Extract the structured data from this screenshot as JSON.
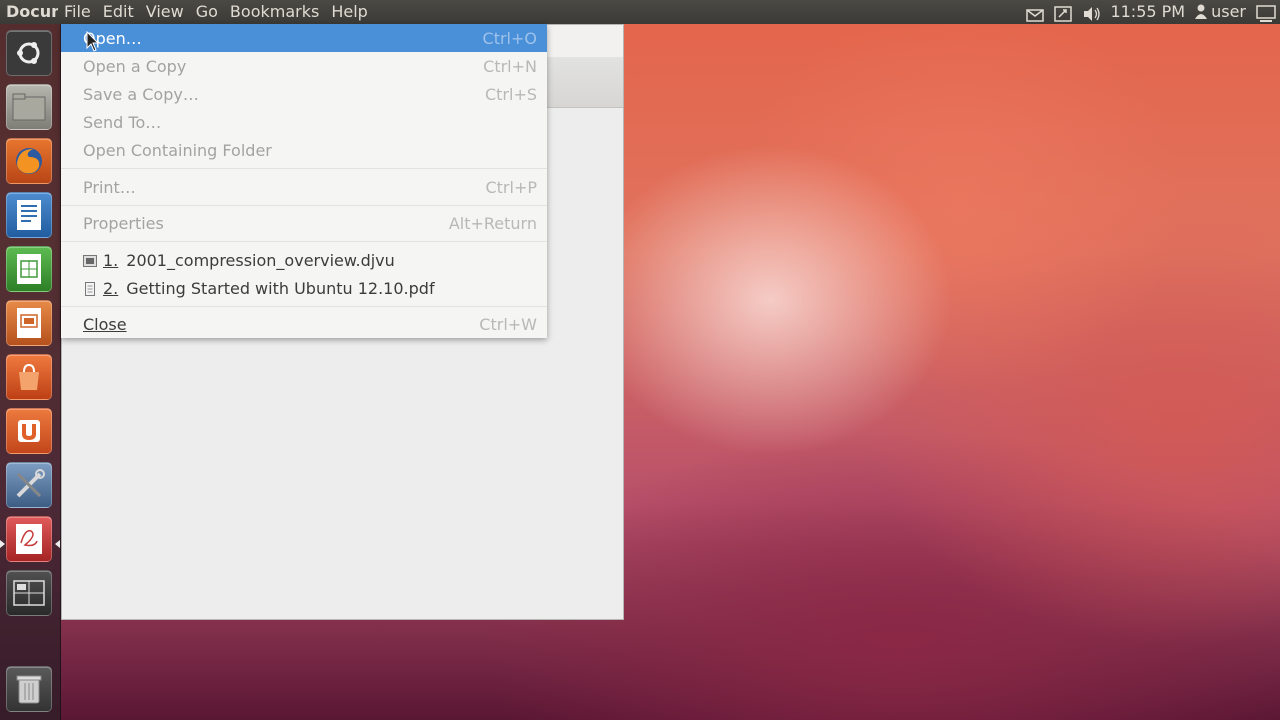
{
  "top_panel": {
    "app_title": "Docun",
    "menus": [
      "File",
      "Edit",
      "View",
      "Go",
      "Bookmarks",
      "Help"
    ],
    "clock": "11:55 PM",
    "user": "user",
    "indicator_icons": [
      "mail-icon",
      "keyboard-icon",
      "volume-icon",
      "user-icon",
      "system-settings-icon"
    ]
  },
  "launcher": {
    "items": [
      {
        "name": "dash-home",
        "icon": "ubuntu-logo-icon",
        "color": "#3b3b3b"
      },
      {
        "name": "files",
        "icon": "folder-icon",
        "color": "#8a8a80"
      },
      {
        "name": "firefox",
        "icon": "firefox-icon",
        "color": "#e0662b"
      },
      {
        "name": "libreoffice-writer",
        "icon": "writer-icon",
        "color": "#2f6fb0"
      },
      {
        "name": "libreoffice-calc",
        "icon": "calc-icon",
        "color": "#3f9a3a"
      },
      {
        "name": "libreoffice-impress",
        "icon": "impress-icon",
        "color": "#d0652a"
      },
      {
        "name": "software-center",
        "icon": "shopping-bag-icon",
        "color": "#e26030"
      },
      {
        "name": "ubuntu-one",
        "icon": "ubuntu-one-icon",
        "color": "#e0602a"
      },
      {
        "name": "system-settings",
        "icon": "tools-icon",
        "color": "#4d6f95"
      },
      {
        "name": "document-viewer",
        "icon": "document-viewer-icon",
        "color": "#c83a3a"
      },
      {
        "name": "workspace-switcher",
        "icon": "workspace-icon",
        "color": "#3a3a3a"
      },
      {
        "name": "trash",
        "icon": "trash-icon",
        "color": "#4a4a4a"
      }
    ]
  },
  "file_menu": {
    "items": [
      {
        "label": "Open…",
        "accel": "Ctrl+O",
        "state": "active"
      },
      {
        "label": "Open a Copy",
        "accel": "Ctrl+N",
        "state": "disabled"
      },
      {
        "label": "Save a Copy…",
        "accel": "Ctrl+S",
        "state": "disabled"
      },
      {
        "label": "Send To…",
        "accel": "",
        "state": "disabled"
      },
      {
        "label": "Open Containing Folder",
        "accel": "",
        "state": "disabled"
      },
      {
        "label": "Print…",
        "accel": "Ctrl+P",
        "state": "disabled"
      },
      {
        "label": "Properties",
        "accel": "Alt+Return",
        "state": "disabled"
      },
      {
        "number": "1.",
        "label": "2001_compression_overview.djvu",
        "accel": "",
        "state": "enabled",
        "icon": "djvu-file-icon"
      },
      {
        "number": "2.",
        "label": "Getting Started with Ubuntu 12.10.pdf",
        "accel": "",
        "state": "enabled",
        "icon": "pdf-file-icon"
      },
      {
        "label": "Close",
        "accel": "Ctrl+W",
        "state": "enabled"
      }
    ]
  },
  "colors": {
    "menu_highlight": "#4a90d9",
    "panel_bg": "#3b3a36"
  }
}
